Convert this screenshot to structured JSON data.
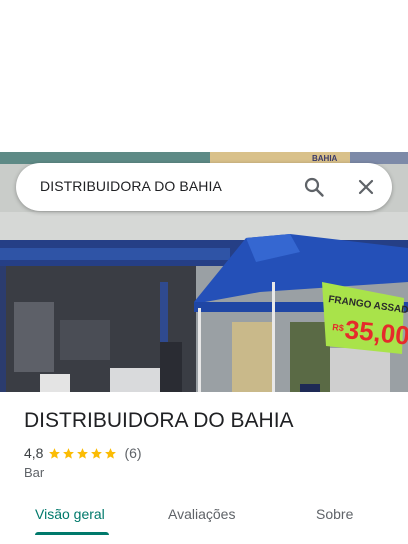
{
  "search": {
    "query": "DISTRIBUIDORA DO BAHIA",
    "search_icon": "search-icon",
    "close_icon": "close-icon"
  },
  "photo": {
    "sign_top": "BAHIA",
    "banner_line1": "FRANGO ASSADO",
    "banner_price_prefix": "R$",
    "banner_price": "35,00"
  },
  "place": {
    "name": "DISTRIBUIDORA DO BAHIA",
    "rating": "4,8",
    "stars": 5,
    "review_count": "(6)",
    "category": "Bar"
  },
  "tabs": [
    {
      "label": "Visão geral",
      "active": true
    },
    {
      "label": "Avaliações",
      "active": false
    },
    {
      "label": "Sobre",
      "active": false
    }
  ],
  "colors": {
    "accent": "#00796b",
    "star": "#fbbc04",
    "text_primary": "#202124",
    "text_secondary": "#5f6368"
  }
}
